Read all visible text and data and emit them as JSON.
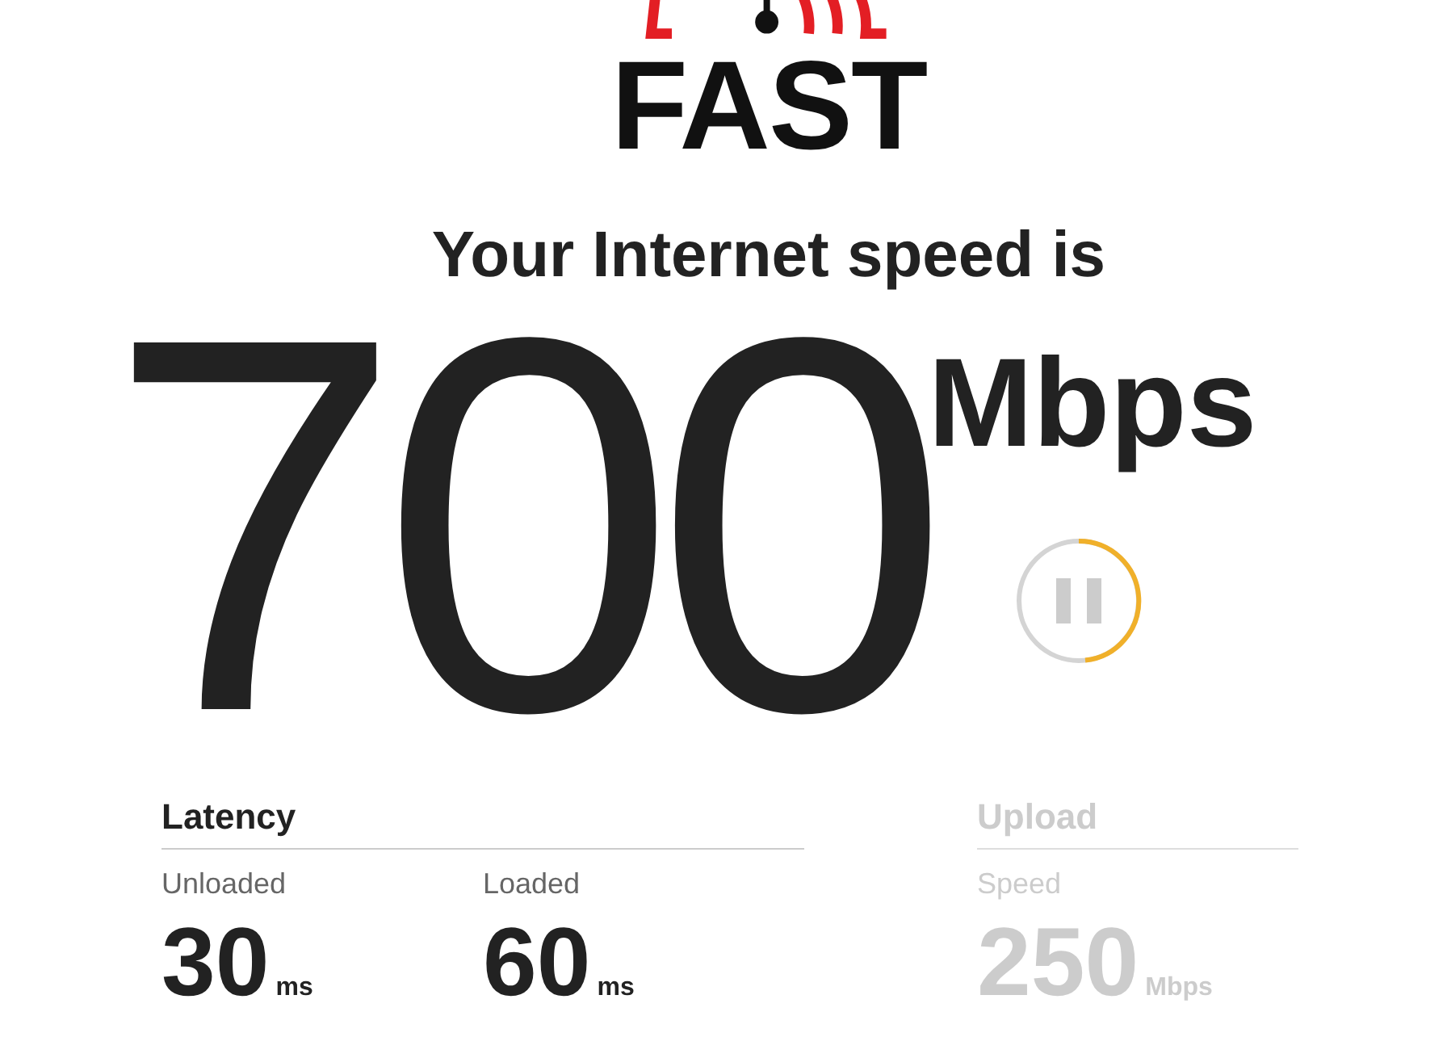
{
  "logo": {
    "text": "FAST"
  },
  "headline": "Your Internet speed is",
  "speed": {
    "value": "700",
    "unit": "Mbps"
  },
  "test": {
    "running": true
  },
  "groups": [
    {
      "title": "Latency",
      "dimmed": false,
      "metrics": [
        {
          "label": "Unloaded",
          "value": "30",
          "unit": "ms"
        },
        {
          "label": "Loaded",
          "value": "60",
          "unit": "ms"
        }
      ]
    },
    {
      "title": "Upload",
      "dimmed": true,
      "metrics": [
        {
          "label": "Speed",
          "value": "250",
          "unit": "Mbps"
        }
      ]
    }
  ]
}
